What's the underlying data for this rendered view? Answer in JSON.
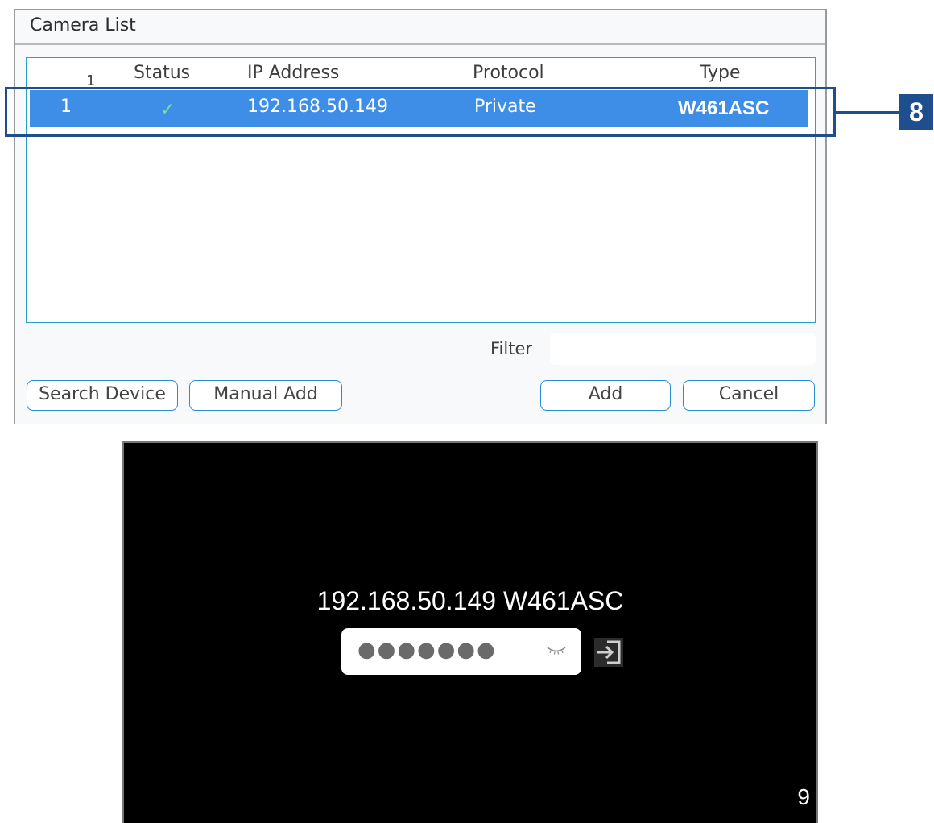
{
  "camera_list": {
    "title": "Camera List",
    "columns": {
      "index_small": "1",
      "status": "Status",
      "ip": "IP Address",
      "protocol": "Protocol",
      "type": "Type"
    },
    "rows": [
      {
        "index": "1",
        "status": "✓",
        "ip": "192.168.50.149",
        "protocol": "Private",
        "type": "W461ASC"
      }
    ],
    "filter_label": "Filter",
    "filter_value": "",
    "buttons": {
      "search": "Search Device",
      "manual": "Manual Add",
      "add": "Add",
      "cancel": "Cancel"
    }
  },
  "callout": {
    "label": "8"
  },
  "live_view": {
    "device_title": "192.168.50.149 W461ASC",
    "password_mask": "●●●●●●●",
    "channel_number": "9"
  }
}
